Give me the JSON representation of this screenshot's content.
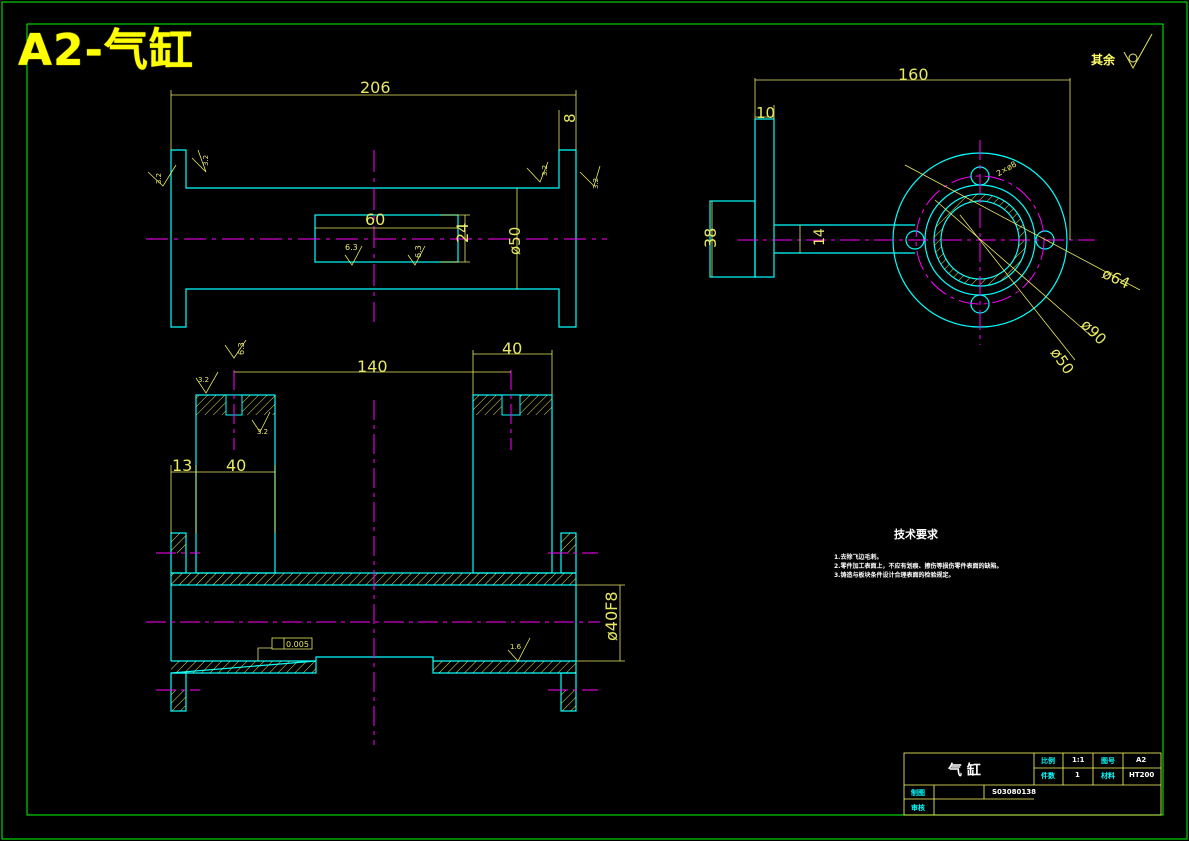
{
  "banner": "A2-气缸",
  "roughness_note": "其余",
  "dims": {
    "top_overall": "206",
    "top_flange": "8",
    "top_slot_len": "60",
    "top_slot_w": "24",
    "top_bore": "ø50",
    "side_overall": "160",
    "side_flange": "10",
    "side_height": "38",
    "side_shaft": "14",
    "circle_64": "ø64",
    "circle_90": "ø90",
    "circle_50": "ø50",
    "hole_label": "2×ø8",
    "front_span": "140",
    "front_right_w": "40",
    "front_left_w": "40",
    "front_offset": "13",
    "front_bore": "ø40F8",
    "tolerance": "0.005"
  },
  "roughness": {
    "r1": "3.2",
    "r2": "3.2",
    "r3": "3.2",
    "r4": "3.2",
    "r5": "6.3",
    "r6": "6.3",
    "r7": "6.3",
    "r8": "3.2",
    "r9": "3.2",
    "r10": "1.6"
  },
  "tech_req": {
    "title": "技术要求",
    "items": [
      "1.去除飞边毛刺。",
      "2.零件加工表面上，不应有划痕、擦伤等损伤零件表面的缺陷。",
      "3.铸造与板块条件设计合理表面的检验规定。"
    ]
  },
  "title_block": {
    "name": "气  缸",
    "scale_label": "比例",
    "scale": "1:1",
    "sheet_label": "图号",
    "sheet": "A2",
    "qty_label": "件数",
    "qty": "1",
    "material_label": "材料",
    "material": "HT200",
    "drawn_label": "制图",
    "drawing_no": "S03080138",
    "checked_label": "审核"
  },
  "colors": {
    "frame": "#00ff00",
    "outline": "#00ffff",
    "centerline": "#ff00ff",
    "dimension": "#e8e864",
    "banner": "#ffff00"
  }
}
